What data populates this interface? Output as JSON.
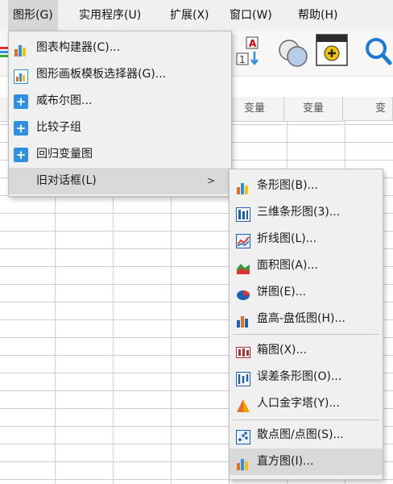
{
  "menubar": {
    "graph": "图形(G)",
    "utilities": "实用程序(U)",
    "extensions": "扩展(X)",
    "window": "窗口(W)",
    "help": "帮助(H)"
  },
  "grid": {
    "column_headers": [
      "变量",
      "变量",
      "变"
    ]
  },
  "graph_menu": {
    "items": [
      {
        "label": "图表构建器(C)...",
        "icon": "chart-builder-icon"
      },
      {
        "label": "图形画板模板选择器(G)...",
        "icon": "template-chooser-icon"
      },
      {
        "label": "威布尔图...",
        "icon": "plus-icon"
      },
      {
        "label": "比较子组",
        "icon": "plus-icon"
      },
      {
        "label": "回归变量图",
        "icon": "plus-icon"
      },
      {
        "label": "旧对话框(L)",
        "icon": ""
      }
    ],
    "submenu_arrow": ">"
  },
  "legacy_submenu": {
    "items": [
      {
        "label": "条形图(B)...",
        "icon": "bar-chart-icon"
      },
      {
        "label": "三维条形图(3)...",
        "icon": "3d-bar-chart-icon"
      },
      {
        "label": "折线图(L)...",
        "icon": "line-chart-icon"
      },
      {
        "label": "面积图(A)...",
        "icon": "area-chart-icon"
      },
      {
        "label": "饼图(E)...",
        "icon": "pie-chart-icon"
      },
      {
        "label": "盘高-盘低图(H)...",
        "icon": "high-low-chart-icon"
      },
      {
        "label": "箱图(X)...",
        "icon": "boxplot-icon"
      },
      {
        "label": "误差条形图(O)...",
        "icon": "error-bar-icon"
      },
      {
        "label": "人口金字塔(Y)...",
        "icon": "pyramid-icon"
      },
      {
        "label": "散点图/点图(S)...",
        "icon": "scatter-icon"
      },
      {
        "label": "直方图(I)...",
        "icon": "histogram-icon"
      }
    ]
  },
  "colors": {
    "menu_bg": "#f0f0f0",
    "highlight": "#d9d9d9",
    "accent_blue": "#2f8fe0"
  }
}
